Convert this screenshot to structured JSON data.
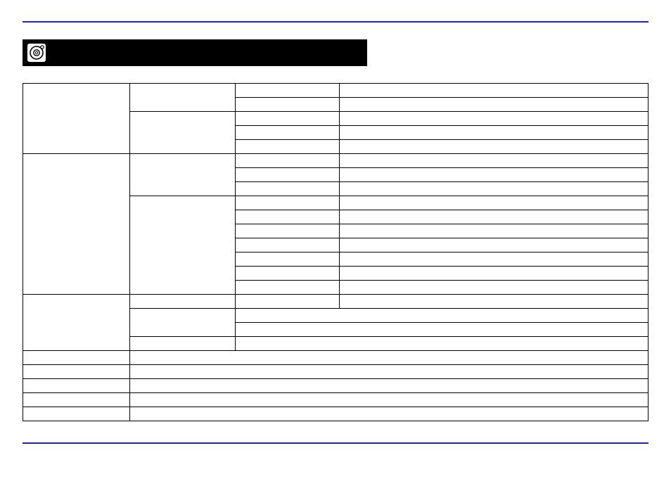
{
  "header": {
    "title": "",
    "icon": "disc-icon"
  },
  "table": {
    "rows": [
      {
        "c1": "",
        "c2": "",
        "c3": "",
        "c4": ""
      },
      {
        "c1": null,
        "c2": null,
        "c3": "",
        "c4": ""
      },
      {
        "c1": null,
        "c2": "",
        "c3": "",
        "c4": ""
      },
      {
        "c1": null,
        "c2": null,
        "c3": "",
        "c4": ""
      },
      {
        "c1": null,
        "c2": null,
        "c3": "",
        "c4": ""
      },
      {
        "c1": "",
        "c2": "",
        "c3": "",
        "c4": ""
      },
      {
        "c1": null,
        "c2": null,
        "c3": "",
        "c4": ""
      },
      {
        "c1": null,
        "c2": null,
        "c3": "",
        "c4": ""
      },
      {
        "c1": null,
        "c2": "",
        "c3": "",
        "c4": ""
      },
      {
        "c1": null,
        "c2": null,
        "c3": "",
        "c4": ""
      },
      {
        "c1": null,
        "c2": null,
        "c3": "",
        "c4": ""
      },
      {
        "c1": null,
        "c2": null,
        "c3": "",
        "c4": ""
      },
      {
        "c1": null,
        "c2": null,
        "c3": "",
        "c4": ""
      },
      {
        "c1": null,
        "c2": null,
        "c3": "",
        "c4": ""
      },
      {
        "c1": null,
        "c2": null,
        "c3": "",
        "c4": ""
      },
      {
        "c1": "",
        "c2": "",
        "c3": "",
        "c4": ""
      },
      {
        "c1": null,
        "c2": "",
        "c34": ""
      },
      {
        "c1": null,
        "c2": null,
        "c34": ""
      },
      {
        "c1": null,
        "c2": "",
        "c34": ""
      },
      {
        "c1": "",
        "c234": ""
      },
      {
        "c1": "",
        "c234": ""
      },
      {
        "c1": "",
        "c234": ""
      },
      {
        "c1": "",
        "c234": ""
      },
      {
        "c1": "",
        "c234": ""
      }
    ]
  }
}
